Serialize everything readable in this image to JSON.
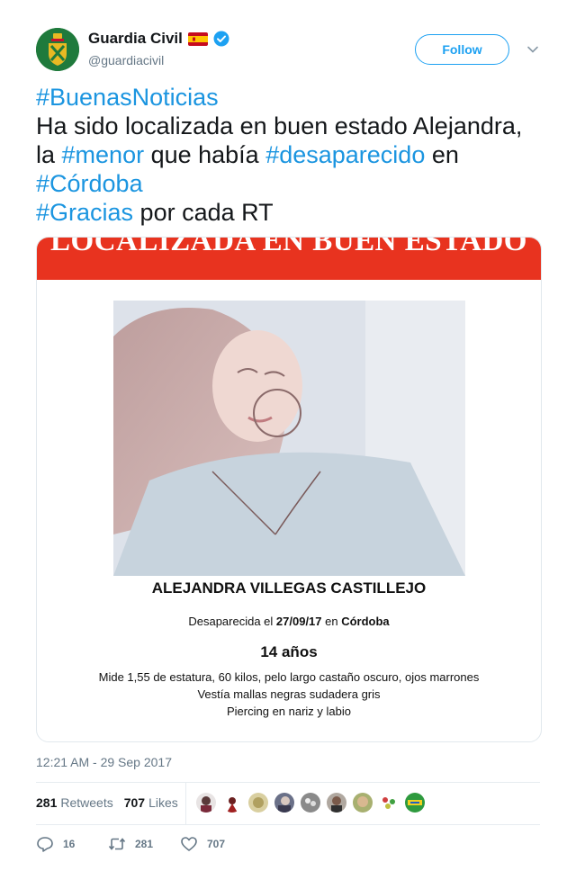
{
  "header": {
    "display_name": "Guardia Civil",
    "handle": "@guardiacivil",
    "follow_label": "Follow"
  },
  "tweet": {
    "line1": {
      "tag": "#BuenasNoticias"
    },
    "line2": {
      "text": "Ha sido localizada en buen estado Alejandra,"
    },
    "line3": {
      "pre": "la ",
      "tag1": "#menor",
      "mid": " que había ",
      "tag2": "#desaparecido",
      "post": " en"
    },
    "line4": {
      "tag": "#Córdoba"
    },
    "line5": {
      "tag": "#Gracias",
      "post": " por cada RT"
    }
  },
  "media": {
    "banner": "LOCALIZADA EN BUEN ESTADO",
    "person_name": "ALEJANDRA VILLEGAS CASTILLEJO",
    "missing_label": "Desaparecida el ",
    "missing_date": "27/09/17",
    "missing_in": " en ",
    "missing_city": "Córdoba",
    "age": "14 años",
    "description": [
      "Mide 1,55 de estatura, 60 kilos, pelo largo castaño oscuro, ojos marrones",
      "Vestía mallas negras sudadera gris",
      "Piercing en nariz y labio"
    ]
  },
  "meta": {
    "timestamp": "12:21 AM - 29 Sep 2017",
    "retweets_count": "281",
    "retweets_label": "Retweets",
    "likes_count": "707",
    "likes_label": "Likes"
  },
  "actions": {
    "replies": "16",
    "retweets": "281",
    "likes": "707"
  },
  "colors": {
    "accent": "#1da1f2",
    "hashtag": "#1b95e0",
    "banner": "#e8331f",
    "muted": "#657786"
  },
  "icons": [
    "guardia-civil-logo",
    "spain-flag-icon",
    "verified-badge-icon",
    "chevron-down-icon",
    "reply-icon",
    "retweet-icon",
    "heart-icon"
  ]
}
